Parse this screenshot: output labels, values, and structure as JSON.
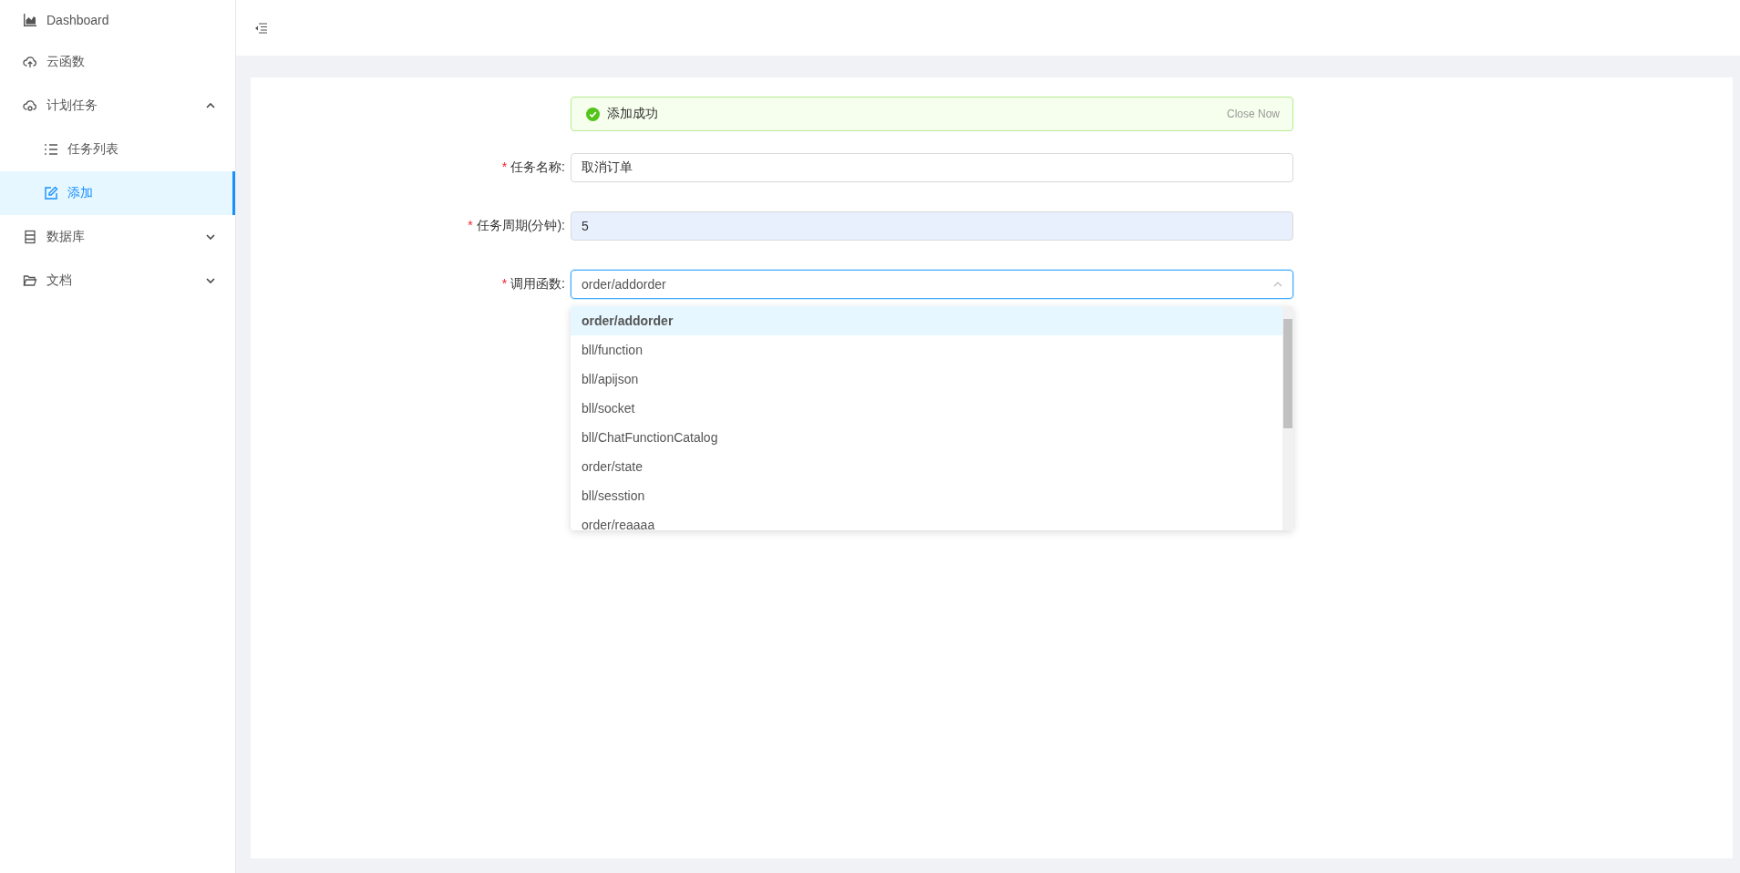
{
  "sidebar": {
    "items": [
      {
        "label": "Dashboard",
        "selected": false
      },
      {
        "label": "云函数",
        "selected": false
      },
      {
        "label": "计划任务",
        "expanded": true,
        "selected": false,
        "children": [
          {
            "label": "任务列表",
            "selected": false
          },
          {
            "label": "添加",
            "selected": true
          }
        ]
      },
      {
        "label": "数据库",
        "expanded": false,
        "selected": false
      },
      {
        "label": "文档",
        "expanded": false,
        "selected": false
      }
    ]
  },
  "alert": {
    "message": "添加成功",
    "close": "Close Now"
  },
  "form": {
    "fields": [
      {
        "kind": "input",
        "required_mark": "*",
        "label": "任务名称:",
        "value": "取消订单",
        "autofilled": false,
        "focused": false
      },
      {
        "kind": "input",
        "required_mark": "*",
        "label": "任务周期(分钟):",
        "value": "5",
        "autofilled": true,
        "focused": false
      },
      {
        "kind": "select",
        "required_mark": "*",
        "label": "调用函数:",
        "value": "order/addorder",
        "autofilled": false,
        "focused": true,
        "expanded": true,
        "options": [
          {
            "label": "order/addorder",
            "selected": true
          },
          {
            "label": "bll/function",
            "selected": false
          },
          {
            "label": "bll/apijson",
            "selected": false
          },
          {
            "label": "bll/socket",
            "selected": false
          },
          {
            "label": "bll/ChatFunctionCatalog",
            "selected": false
          },
          {
            "label": "order/state",
            "selected": false
          },
          {
            "label": "bll/sesstion",
            "selected": false
          },
          {
            "label": "order/reaaaa",
            "selected": false
          }
        ]
      }
    ]
  }
}
